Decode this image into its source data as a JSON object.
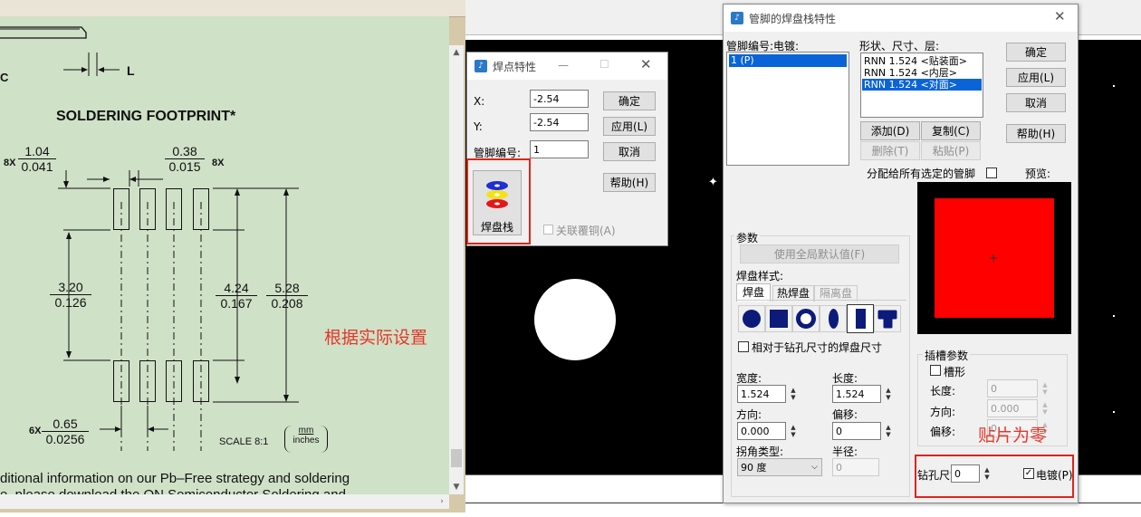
{
  "pdf": {
    "dim_L": "L",
    "dim_C": "C",
    "footprint_title": "SOLDERING FOOTPRINT*",
    "dim_width_top": "1.04",
    "dim_width_bottom": "0.041",
    "dim_pitch_top": "0.38",
    "dim_pitch_bottom": "0.015",
    "mult_8x_left": "8X",
    "mult_8x_right": "8X",
    "dim_gap_top": "3.20",
    "dim_gap_bottom": "0.126",
    "dim_inner_top": "4.24",
    "dim_inner_bottom": "0.167",
    "dim_outer_top": "5.28",
    "dim_outer_bottom": "0.208",
    "mult_6x": "6X",
    "dim_pitch2_top": "0.65",
    "dim_pitch2_bottom": "0.0256",
    "scale": "SCALE 8:1",
    "units_top": "mm",
    "units_bottom": "inches",
    "footer_line1": "ditional information on our Pb–Free strategy and soldering",
    "footer_line2": "e, please download the ON Semiconductor Soldering and"
  },
  "annotations": {
    "set_actual": "根据实际设置",
    "smd_zero": "贴片为零"
  },
  "pad_dialog": {
    "title": "焊点特性",
    "x_label": "X:",
    "x_value": "-2.54",
    "y_label": "Y:",
    "y_value": "-2.54",
    "pin_label": "管脚编号:",
    "pin_value": "1",
    "ok": "确定",
    "apply": "应用(L)",
    "cancel": "取消",
    "help": "帮助(H)",
    "padstack_label": "焊盘栈",
    "copper_link": "关联覆铜(A)"
  },
  "stack_dialog": {
    "title": "管脚的焊盘栈特性",
    "pin_list_label": "管脚编号:电镀:",
    "pin_items": [
      "1 (P)"
    ],
    "shape_label": "形状、尺寸、层:",
    "shape_items": [
      "RNN 1.524 <贴装面>",
      "RNN 1.524 <内层>",
      "RNN 1.524 <对面>"
    ],
    "ok": "确定",
    "apply": "应用(L)",
    "cancel": "取消",
    "help": "帮助(H)",
    "add": "添加(D)",
    "copy": "复制(C)",
    "delete": "删除(T)",
    "paste": "粘贴(P)",
    "assign_all": "分配给所有选定的管脚",
    "preview_label": "预览:",
    "params_label": "参数",
    "use_global": "使用全局默认值(F)",
    "pad_style_label": "焊盘样式:",
    "tabs": [
      "焊盘",
      "热焊盘",
      "隔离盘"
    ],
    "relative_drill": "相对于钻孔尺寸的焊盘尺寸",
    "width_label": "宽度:",
    "width_value": "1.524",
    "length_label": "长度:",
    "length_value": "1.524",
    "orient_label": "方向:",
    "orient_value": "0.000",
    "offset_label": "偏移:",
    "offset_value": "0",
    "corner_label": "拐角类型:",
    "corner_value": "90 度",
    "radius_label": "半径:",
    "radius_value": "0",
    "slot_label": "插槽参数",
    "slot_check": "槽形",
    "slot_length_label": "长度:",
    "slot_length_value": "0",
    "slot_orient_label": "方向:",
    "slot_orient_value": "0.000",
    "slot_offset_label": "偏移:",
    "slot_offset_value": "0",
    "drill_label": "钻孔尺寸(Z):",
    "drill_value": "0",
    "plated_label": "电镀(P)"
  },
  "colors": {
    "preview_pad": "#ff0000",
    "annotation": "#e5372b",
    "selection": "#0a64d8",
    "shape_icon": "#0c1b7a"
  }
}
